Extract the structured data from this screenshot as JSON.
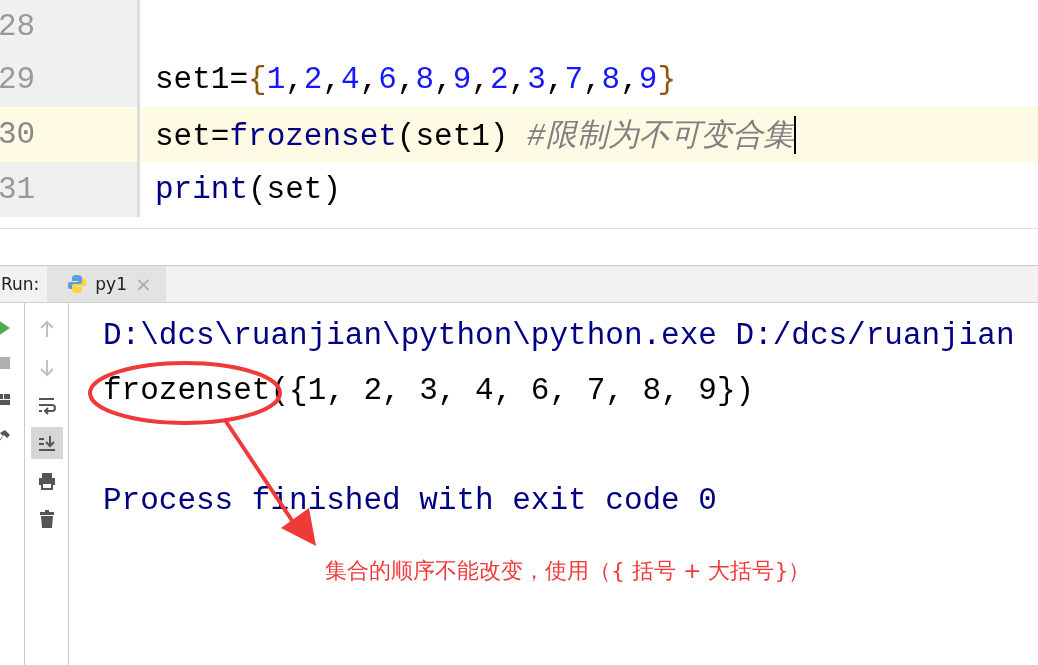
{
  "editor": {
    "lines": [
      {
        "number": "28",
        "current": false
      },
      {
        "number": "29",
        "current": false,
        "tokens": [
          {
            "text": "set1=",
            "kind": "plain"
          },
          {
            "text": "{",
            "kind": "brace"
          },
          {
            "text": "1",
            "kind": "number"
          },
          {
            "text": ",",
            "kind": "plain"
          },
          {
            "text": "2",
            "kind": "number"
          },
          {
            "text": ",",
            "kind": "plain"
          },
          {
            "text": "4",
            "kind": "number"
          },
          {
            "text": ",",
            "kind": "plain"
          },
          {
            "text": "6",
            "kind": "number"
          },
          {
            "text": ",",
            "kind": "plain"
          },
          {
            "text": "8",
            "kind": "number"
          },
          {
            "text": ",",
            "kind": "plain"
          },
          {
            "text": "9",
            "kind": "number"
          },
          {
            "text": ",",
            "kind": "plain"
          },
          {
            "text": "2",
            "kind": "number"
          },
          {
            "text": ",",
            "kind": "plain"
          },
          {
            "text": "3",
            "kind": "number"
          },
          {
            "text": ",",
            "kind": "plain"
          },
          {
            "text": "7",
            "kind": "number"
          },
          {
            "text": ",",
            "kind": "plain"
          },
          {
            "text": "8",
            "kind": "number"
          },
          {
            "text": ",",
            "kind": "plain"
          },
          {
            "text": "9",
            "kind": "number"
          },
          {
            "text": "}",
            "kind": "brace"
          }
        ]
      },
      {
        "number": "30",
        "current": true,
        "caret": true,
        "tokens": [
          {
            "text": "set=",
            "kind": "plain"
          },
          {
            "text": "frozenset",
            "kind": "builtin"
          },
          {
            "text": "(set1) ",
            "kind": "plain"
          },
          {
            "text": "#限制为不可变合集",
            "kind": "comment"
          }
        ]
      },
      {
        "number": "31",
        "current": false,
        "tokens": [
          {
            "text": "print",
            "kind": "builtin"
          },
          {
            "text": "(set)",
            "kind": "plain"
          }
        ]
      }
    ]
  },
  "run_panel": {
    "label": "Run:",
    "tabs": [
      {
        "label": "py1",
        "close": "×",
        "selected": true
      }
    ],
    "left_tools": [
      {
        "kind": "run"
      },
      {
        "kind": "stop"
      },
      {
        "kind": "layout"
      },
      {
        "kind": "pin"
      }
    ],
    "tools": [
      {
        "kind": "up",
        "disabled": true,
        "on": false
      },
      {
        "kind": "down",
        "disabled": true,
        "on": false
      },
      {
        "kind": "wrap",
        "disabled": false,
        "on": false
      },
      {
        "kind": "scroll-end",
        "disabled": false,
        "on": true
      },
      {
        "kind": "print",
        "disabled": false,
        "on": false
      },
      {
        "kind": "trash",
        "disabled": false,
        "on": false
      }
    ],
    "console": [
      {
        "text": "D:\\dcs\\ruanjian\\python\\python.exe D:/dcs/ruanjian",
        "kind": "system"
      },
      {
        "text": "frozenset({1, 2, 3, 4, 6, 7, 8, 9})",
        "kind": "output"
      },
      {
        "kind": "blank"
      },
      {
        "text": "Process finished with exit code 0",
        "kind": "system"
      }
    ]
  },
  "annotation": {
    "text": "集合的顺序不能改变，使用（{ 括号 + 大括号}）"
  }
}
